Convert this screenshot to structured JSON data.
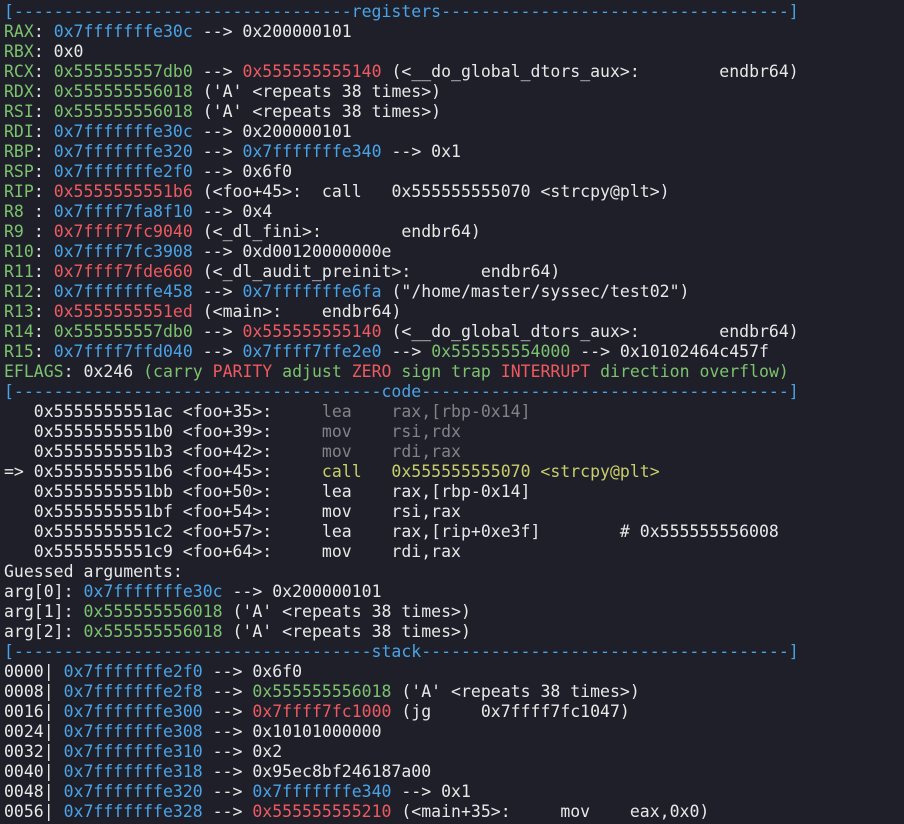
{
  "window": {
    "background": "#1e1f29"
  },
  "palette": {
    "default": "#e8e8e8",
    "blue": "#4aa3e6",
    "red": "#ef5a60",
    "green": "#7cc36e",
    "yellow": "#c9ce6a",
    "gray": "#808487"
  },
  "lines": [
    {
      "name": "registers-header",
      "segs": [
        [
          "blue",
          "[----------------------------------registers-----------------------------------]"
        ]
      ]
    },
    {
      "name": "reg-rax",
      "segs": [
        [
          "green",
          "RAX"
        ],
        [
          "default",
          ": "
        ],
        [
          "blue",
          "0x7fffffffe30c"
        ],
        [
          "default",
          " --> 0x200000101"
        ]
      ]
    },
    {
      "name": "reg-rbx",
      "segs": [
        [
          "green",
          "RBX"
        ],
        [
          "default",
          ": 0x0"
        ]
      ]
    },
    {
      "name": "reg-rcx",
      "segs": [
        [
          "green",
          "RCX"
        ],
        [
          "default",
          ": "
        ],
        [
          "green",
          "0x555555557db0"
        ],
        [
          "default",
          " --> "
        ],
        [
          "red",
          "0x555555555140"
        ],
        [
          "default",
          " (<__do_global_dtors_aux>:        endbr64)"
        ]
      ]
    },
    {
      "name": "reg-rdx",
      "segs": [
        [
          "green",
          "RDX"
        ],
        [
          "default",
          ": "
        ],
        [
          "green",
          "0x555555556018"
        ],
        [
          "default",
          " ('A' <repeats 38 times>)"
        ]
      ]
    },
    {
      "name": "reg-rsi",
      "segs": [
        [
          "green",
          "RSI"
        ],
        [
          "default",
          ": "
        ],
        [
          "green",
          "0x555555556018"
        ],
        [
          "default",
          " ('A' <repeats 38 times>)"
        ]
      ]
    },
    {
      "name": "reg-rdi",
      "segs": [
        [
          "green",
          "RDI"
        ],
        [
          "default",
          ": "
        ],
        [
          "blue",
          "0x7fffffffe30c"
        ],
        [
          "default",
          " --> 0x200000101"
        ]
      ]
    },
    {
      "name": "reg-rbp",
      "segs": [
        [
          "green",
          "RBP"
        ],
        [
          "default",
          ": "
        ],
        [
          "blue",
          "0x7fffffffe320"
        ],
        [
          "default",
          " --> "
        ],
        [
          "blue",
          "0x7fffffffe340"
        ],
        [
          "default",
          " --> 0x1"
        ]
      ]
    },
    {
      "name": "reg-rsp",
      "segs": [
        [
          "green",
          "RSP"
        ],
        [
          "default",
          ": "
        ],
        [
          "blue",
          "0x7fffffffe2f0"
        ],
        [
          "default",
          " --> 0x6f0"
        ]
      ]
    },
    {
      "name": "reg-rip",
      "segs": [
        [
          "green",
          "RIP"
        ],
        [
          "default",
          ": "
        ],
        [
          "red",
          "0x5555555551b6"
        ],
        [
          "default",
          " (<foo+45>:  call   0x555555555070 <strcpy@plt>)"
        ]
      ]
    },
    {
      "name": "reg-r8",
      "segs": [
        [
          "green",
          "R8 "
        ],
        [
          "default",
          ": "
        ],
        [
          "blue",
          "0x7ffff7fa8f10"
        ],
        [
          "default",
          " --> 0x4"
        ]
      ]
    },
    {
      "name": "reg-r9",
      "segs": [
        [
          "green",
          "R9 "
        ],
        [
          "default",
          ": "
        ],
        [
          "red",
          "0x7ffff7fc9040"
        ],
        [
          "default",
          " (<_dl_fini>:        endbr64)"
        ]
      ]
    },
    {
      "name": "reg-r10",
      "segs": [
        [
          "green",
          "R10"
        ],
        [
          "default",
          ": "
        ],
        [
          "blue",
          "0x7ffff7fc3908"
        ],
        [
          "default",
          " --> 0xd00120000000e"
        ]
      ]
    },
    {
      "name": "reg-r11",
      "segs": [
        [
          "green",
          "R11"
        ],
        [
          "default",
          ": "
        ],
        [
          "red",
          "0x7ffff7fde660"
        ],
        [
          "default",
          " (<_dl_audit_preinit>:       endbr64)"
        ]
      ]
    },
    {
      "name": "reg-r12",
      "segs": [
        [
          "green",
          "R12"
        ],
        [
          "default",
          ": "
        ],
        [
          "blue",
          "0x7fffffffe458"
        ],
        [
          "default",
          " --> "
        ],
        [
          "blue",
          "0x7fffffffe6fa"
        ],
        [
          "default",
          " (\"/home/master/syssec/test02\")"
        ]
      ]
    },
    {
      "name": "reg-r13",
      "segs": [
        [
          "green",
          "R13"
        ],
        [
          "default",
          ": "
        ],
        [
          "red",
          "0x5555555551ed"
        ],
        [
          "default",
          " (<main>:    endbr64)"
        ]
      ]
    },
    {
      "name": "reg-r14",
      "segs": [
        [
          "green",
          "R14"
        ],
        [
          "default",
          ": "
        ],
        [
          "green",
          "0x555555557db0"
        ],
        [
          "default",
          " --> "
        ],
        [
          "red",
          "0x555555555140"
        ],
        [
          "default",
          " (<__do_global_dtors_aux>:        endbr64)"
        ]
      ]
    },
    {
      "name": "reg-r15",
      "segs": [
        [
          "green",
          "R15"
        ],
        [
          "default",
          ": "
        ],
        [
          "blue",
          "0x7ffff7ffd040"
        ],
        [
          "default",
          " --> "
        ],
        [
          "blue",
          "0x7ffff7ffe2e0"
        ],
        [
          "default",
          " --> "
        ],
        [
          "green",
          "0x555555554000"
        ],
        [
          "default",
          " --> 0x10102464c457f"
        ]
      ]
    },
    {
      "name": "reg-eflags",
      "segs": [
        [
          "green",
          "EFLAGS"
        ],
        [
          "default",
          ": 0x246 "
        ],
        [
          "green",
          "(carry "
        ],
        [
          "red",
          "PARITY"
        ],
        [
          "green",
          " adjust "
        ],
        [
          "red",
          "ZERO"
        ],
        [
          "green",
          " sign trap "
        ],
        [
          "red",
          "INTERRUPT"
        ],
        [
          "green",
          " direction overflow)"
        ]
      ]
    },
    {
      "name": "code-header",
      "segs": [
        [
          "blue",
          "[-------------------------------------code-------------------------------------]"
        ]
      ]
    },
    {
      "name": "code-line",
      "segs": [
        [
          "default",
          "   0x5555555551ac <foo+35>:     "
        ],
        [
          "gray",
          "lea    rax,[rbp-0x14]"
        ]
      ]
    },
    {
      "name": "code-line",
      "segs": [
        [
          "default",
          "   0x5555555551b0 <foo+39>:     "
        ],
        [
          "gray",
          "mov    rsi,rdx"
        ]
      ]
    },
    {
      "name": "code-line",
      "segs": [
        [
          "default",
          "   0x5555555551b3 <foo+42>:     "
        ],
        [
          "gray",
          "mov    rdi,rax"
        ]
      ]
    },
    {
      "name": "code-line-current",
      "segs": [
        [
          "default",
          "=> 0x5555555551b6 <foo+45>:     "
        ],
        [
          "yellow",
          "call   0x555555555070 <strcpy@plt>"
        ]
      ]
    },
    {
      "name": "code-line",
      "segs": [
        [
          "default",
          "   0x5555555551bb <foo+50>:     lea    rax,[rbp-0x14]"
        ]
      ]
    },
    {
      "name": "code-line",
      "segs": [
        [
          "default",
          "   0x5555555551bf <foo+54>:     mov    rsi,rax"
        ]
      ]
    },
    {
      "name": "code-line",
      "segs": [
        [
          "default",
          "   0x5555555551c2 <foo+57>:     lea    rax,[rip+0xe3f]        # 0x555555556008"
        ]
      ]
    },
    {
      "name": "code-line",
      "segs": [
        [
          "default",
          "   0x5555555551c9 <foo+64>:     mov    rdi,rax"
        ]
      ]
    },
    {
      "name": "guessed-arguments-title",
      "segs": [
        [
          "default",
          "Guessed arguments:"
        ]
      ]
    },
    {
      "name": "arg-0",
      "segs": [
        [
          "default",
          "arg[0]: "
        ],
        [
          "blue",
          "0x7fffffffe30c"
        ],
        [
          "default",
          " --> 0x200000101"
        ]
      ]
    },
    {
      "name": "arg-1",
      "segs": [
        [
          "default",
          "arg[1]: "
        ],
        [
          "green",
          "0x555555556018"
        ],
        [
          "default",
          " ('A' <repeats 38 times>)"
        ]
      ]
    },
    {
      "name": "arg-2",
      "segs": [
        [
          "default",
          "arg[2]: "
        ],
        [
          "green",
          "0x555555556018"
        ],
        [
          "default",
          " ('A' <repeats 38 times>)"
        ]
      ]
    },
    {
      "name": "stack-header",
      "segs": [
        [
          "blue",
          "[------------------------------------stack-------------------------------------]"
        ]
      ]
    },
    {
      "name": "stack-line",
      "segs": [
        [
          "default",
          "0000| "
        ],
        [
          "blue",
          "0x7fffffffe2f0"
        ],
        [
          "default",
          " --> 0x6f0"
        ]
      ]
    },
    {
      "name": "stack-line",
      "segs": [
        [
          "default",
          "0008| "
        ],
        [
          "blue",
          "0x7fffffffe2f8"
        ],
        [
          "default",
          " --> "
        ],
        [
          "green",
          "0x555555556018"
        ],
        [
          "default",
          " ('A' <repeats 38 times>)"
        ]
      ]
    },
    {
      "name": "stack-line",
      "segs": [
        [
          "default",
          "0016| "
        ],
        [
          "blue",
          "0x7fffffffe300"
        ],
        [
          "default",
          " --> "
        ],
        [
          "red",
          "0x7ffff7fc1000"
        ],
        [
          "default",
          " (jg     0x7ffff7fc1047)"
        ]
      ]
    },
    {
      "name": "stack-line",
      "segs": [
        [
          "default",
          "0024| "
        ],
        [
          "blue",
          "0x7fffffffe308"
        ],
        [
          "default",
          " --> 0x10101000000"
        ]
      ]
    },
    {
      "name": "stack-line",
      "segs": [
        [
          "default",
          "0032| "
        ],
        [
          "blue",
          "0x7fffffffe310"
        ],
        [
          "default",
          " --> 0x2"
        ]
      ]
    },
    {
      "name": "stack-line",
      "segs": [
        [
          "default",
          "0040| "
        ],
        [
          "blue",
          "0x7fffffffe318"
        ],
        [
          "default",
          " --> 0x95ec8bf246187a00"
        ]
      ]
    },
    {
      "name": "stack-line",
      "segs": [
        [
          "default",
          "0048| "
        ],
        [
          "blue",
          "0x7fffffffe320"
        ],
        [
          "default",
          " --> "
        ],
        [
          "blue",
          "0x7fffffffe340"
        ],
        [
          "default",
          " --> 0x1"
        ]
      ]
    },
    {
      "name": "stack-line",
      "segs": [
        [
          "default",
          "0056| "
        ],
        [
          "blue",
          "0x7fffffffe328"
        ],
        [
          "default",
          " --> "
        ],
        [
          "red",
          "0x555555555210"
        ],
        [
          "default",
          " (<main+35>:     mov    eax,0x0)"
        ]
      ]
    }
  ]
}
